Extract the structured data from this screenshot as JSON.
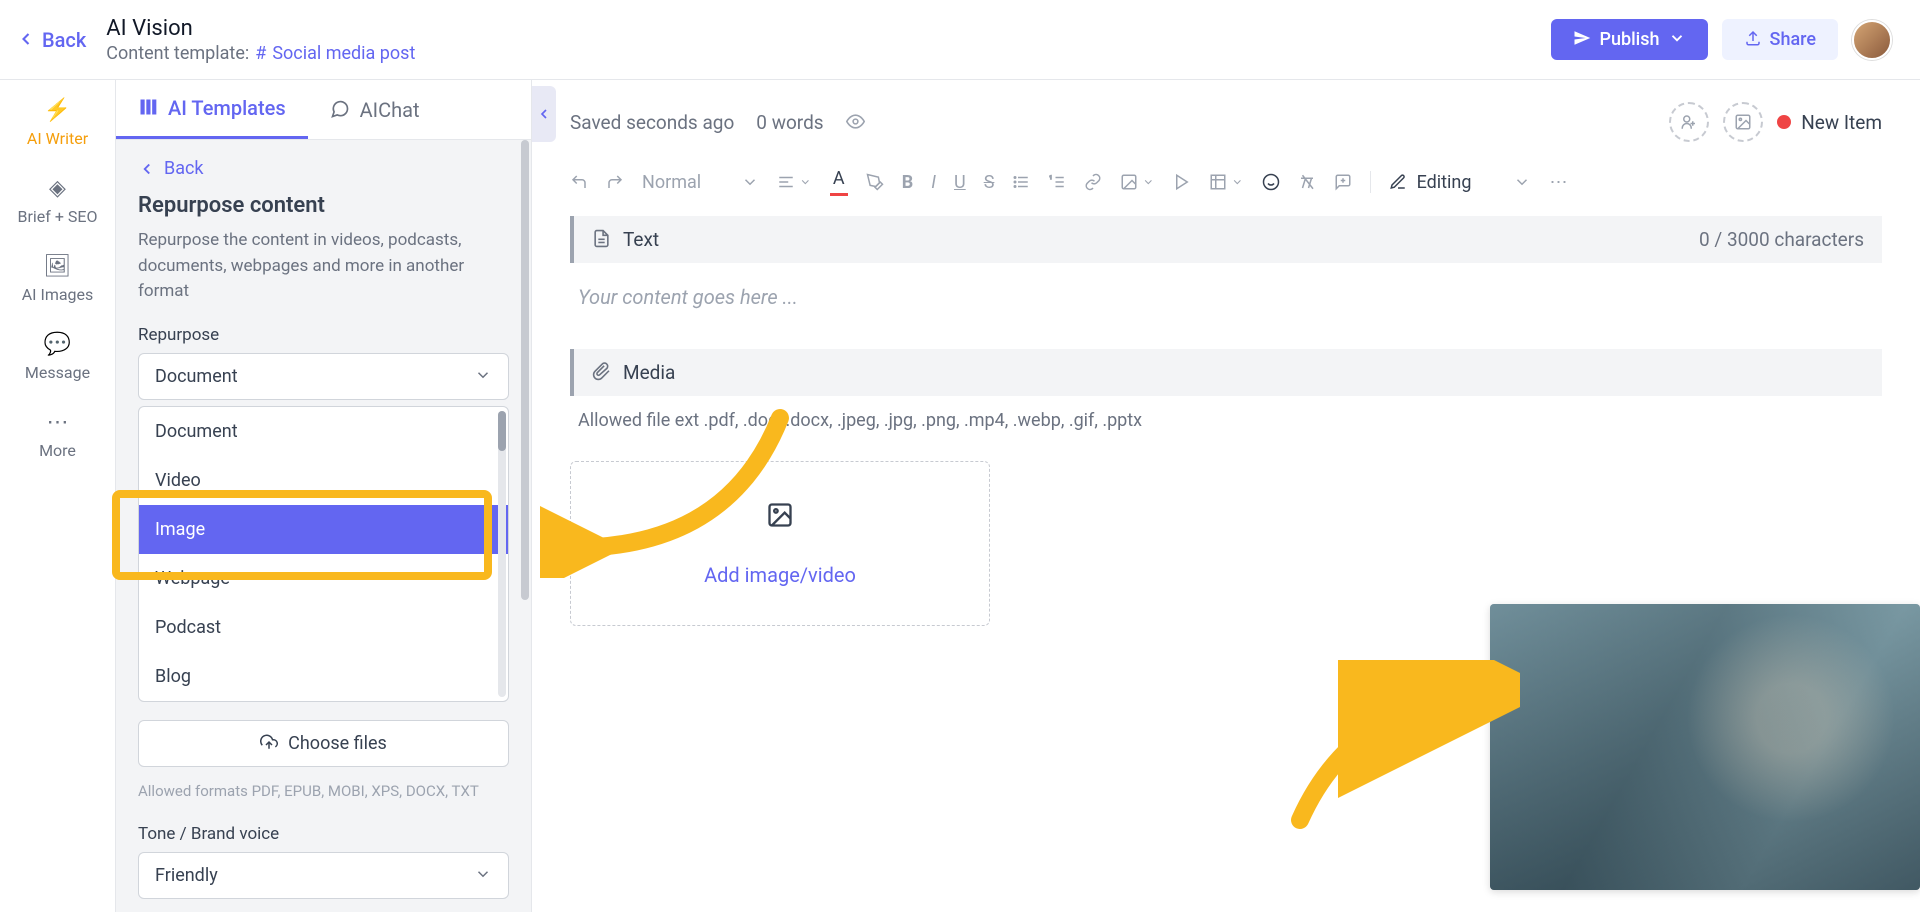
{
  "header": {
    "back": "Back",
    "title": "AI Vision",
    "subtitle_label": "Content template:",
    "subtitle_link": "Social media post",
    "publish": "Publish",
    "share": "Share"
  },
  "rail": {
    "items": [
      {
        "label": "AI Writer",
        "icon": "⚡",
        "active": true
      },
      {
        "label": "Brief + SEO",
        "icon": "◈"
      },
      {
        "label": "AI Images",
        "icon": "🖼"
      },
      {
        "label": "Message",
        "icon": "💬"
      },
      {
        "label": "More",
        "icon": "⋯"
      }
    ]
  },
  "sidebar": {
    "tab_templates": "AI Templates",
    "tab_aichat": "AIChat",
    "back": "Back",
    "heading": "Repurpose content",
    "description": "Repurpose the content in videos, podcasts, documents, webpages and more in another format",
    "repurpose_label": "Repurpose",
    "repurpose_value": "Document",
    "options": [
      "Document",
      "Video",
      "Image",
      "Webpage",
      "Podcast",
      "Blog"
    ],
    "selected_option": "Image",
    "choose_files": "Choose files",
    "allowed_note": "Allowed formats PDF, EPUB, MOBI, XPS, DOCX, TXT",
    "tone_label": "Tone / Brand voice",
    "tone_value": "Friendly"
  },
  "editor": {
    "saved": "Saved seconds ago",
    "word_count": "0 words",
    "new_item": "New Item",
    "toolbar": {
      "style_label": "Normal",
      "editing_label": "Editing"
    },
    "text_block": {
      "title": "Text",
      "counter": "0 / 3000 characters",
      "placeholder": "Your content goes here ..."
    },
    "media_block": {
      "title": "Media",
      "allowed": "Allowed file ext     .pdf, .doc, .docx, .jpeg, .jpg, .png, .mp4, .webp, .gif, .pptx",
      "upload_cta": "Add image/video"
    }
  }
}
